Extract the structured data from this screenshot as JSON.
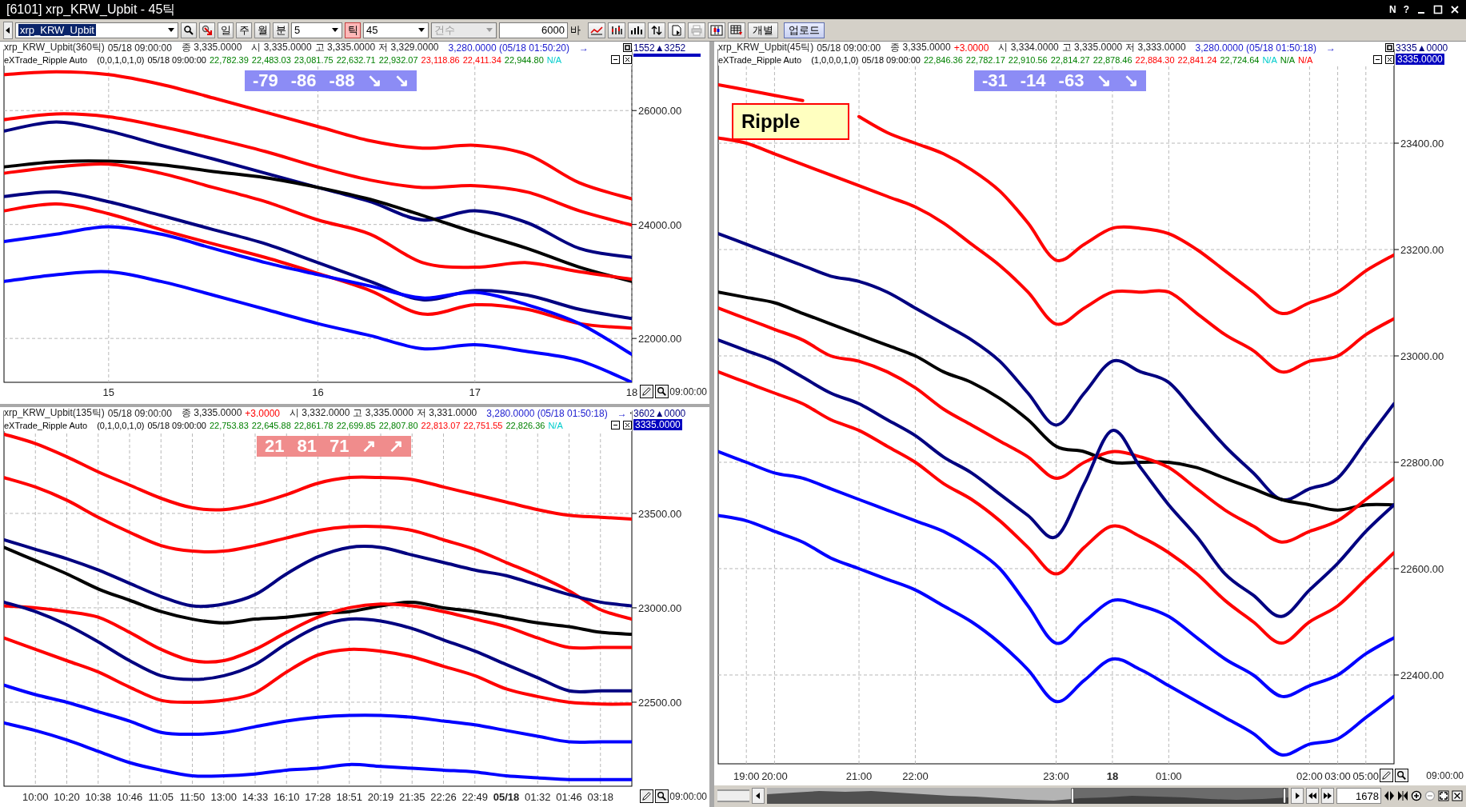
{
  "window": {
    "title": "[6101] xrp_KRW_Upbit - 45틱",
    "buttons": [
      "N",
      "?"
    ]
  },
  "toolbar": {
    "symbol": "xrp_KRW_Upbit",
    "periods": [
      {
        "label": "일",
        "selected": false
      },
      {
        "label": "주",
        "selected": false
      },
      {
        "label": "월",
        "selected": false
      },
      {
        "label": "분",
        "selected": false
      }
    ],
    "minute_value": "5",
    "tick": {
      "label": "틱",
      "selected": true
    },
    "tick_value": "45",
    "count": {
      "label": "건수",
      "disabled": true
    },
    "bars": "6000",
    "bars_unit": "바",
    "individual": "개별",
    "upload": "업로드"
  },
  "panels": [
    {
      "header": {
        "symbol": "xrp_KRW_Upbit(360틱)",
        "datetime": "05/18 09:00:00",
        "close": "종 3,335.0000",
        "ohlc": [
          "시 3,335.0000",
          "고 3,335.0000",
          "저 3,329.0000"
        ],
        "ref": "3,280.0000 (05/18 01:50:20)",
        "arrow": "→"
      },
      "indicator": {
        "name": "eXTrade_Ripple Auto",
        "params": "(0,0,1,0,1,0)",
        "datetime": "05/18 09:00:00",
        "values": [
          {
            "text": "22,782.39",
            "color": "#008000"
          },
          {
            "text": "22,483.03",
            "color": "#008000"
          },
          {
            "text": "23,081.75",
            "color": "#008000"
          },
          {
            "text": "22,632.71",
            "color": "#008000"
          },
          {
            "text": "22,932.07",
            "color": "#008000"
          },
          {
            "text": "23,118.86",
            "color": "#ff0000"
          },
          {
            "text": "22,411.34",
            "color": "#ff0000"
          },
          {
            "text": "22,944.80",
            "color": "#008000"
          },
          {
            "text": "N/A",
            "color": "#00cccc"
          }
        ]
      },
      "signal": {
        "color": "#8c8cf5",
        "items": [
          "-79",
          "-86",
          "-88",
          "↘",
          "↘"
        ]
      },
      "axis_mark": "1552▲3252",
      "time": "09:00:00",
      "chart_data": {
        "type": "line",
        "grid": true,
        "ylim": [
          21230,
          27070
        ],
        "categories": [
          null,
          null,
          "15",
          null,
          null,
          null,
          "16",
          null,
          null,
          "17",
          null,
          null,
          "18"
        ],
        "yticks": [
          {
            "value": 22000,
            "label": "22000.00"
          },
          {
            "value": 24000,
            "label": "24000.00"
          },
          {
            "value": 26000,
            "label": "26000.00"
          }
        ],
        "series": [
          {
            "color": "#ff0000",
            "values": [
              26630,
              26680,
              26630,
              26460,
              26220,
              25970,
              25720,
              25470,
              25340,
              25390,
              25230,
              24730,
              24450
            ]
          },
          {
            "color": "#ff0000",
            "values": [
              25840,
              25940,
              25890,
              25720,
              25510,
              25280,
              25010,
              24780,
              24650,
              24680,
              24570,
              24240,
              23990
            ]
          },
          {
            "color": "#000080",
            "values": [
              25640,
              25800,
              25640,
              25390,
              25150,
              24900,
              24650,
              24400,
              24080,
              24240,
              24030,
              23580,
              23420
            ]
          },
          {
            "color": "#000000",
            "values": [
              25010,
              25100,
              25110,
              25050,
              24930,
              24820,
              24650,
              24440,
              24160,
              23860,
              23580,
              23250,
              23000
            ]
          },
          {
            "color": "#ff0000",
            "values": [
              24900,
              25010,
              25060,
              24900,
              24650,
              24400,
              24080,
              23830,
              23330,
              23250,
              23330,
              23170,
              23040
            ]
          },
          {
            "color": "#000080",
            "values": [
              24490,
              24570,
              24400,
              24160,
              23910,
              23660,
              23330,
              23000,
              22680,
              22840,
              22760,
              22510,
              22350
            ]
          },
          {
            "color": "#ff0000",
            "values": [
              24240,
              24360,
              24190,
              23910,
              23660,
              23420,
              23140,
              22840,
              22430,
              22590,
              22510,
              22260,
              22180
            ]
          },
          {
            "color": "#0000ff",
            "values": [
              23700,
              23830,
              23960,
              23830,
              23580,
              23330,
              23120,
              22920,
              22710,
              22810,
              22590,
              22260,
              21720
            ]
          },
          {
            "color": "#0000ff",
            "values": [
              23000,
              23120,
              23170,
              23000,
              22760,
              22510,
              22260,
              22050,
              21820,
              21890,
              21770,
              21610,
              21230
            ]
          }
        ]
      }
    },
    {
      "header": {
        "symbol": "xrp_KRW_Upbit(135틱)",
        "datetime": "05/18 09:00:00",
        "close": "종 3,335.0000",
        "change": "+3.0000",
        "ohlc": [
          "시 3,332.0000",
          "고 3,335.0000",
          "저 3,331.0000"
        ],
        "ref": "3,280.0000 (05/18 01:50:18)",
        "arrow": "→"
      },
      "indicator": {
        "name": "eXTrade_Ripple Auto",
        "params": "(0,1,0,0,1,0)",
        "datetime": "05/18 09:00:00",
        "values": [
          {
            "text": "22,753.83",
            "color": "#008000"
          },
          {
            "text": "22,645.88",
            "color": "#008000"
          },
          {
            "text": "22,861.78",
            "color": "#008000"
          },
          {
            "text": "22,699.85",
            "color": "#008000"
          },
          {
            "text": "22,807.80",
            "color": "#008000"
          },
          {
            "text": "22,813.07",
            "color": "#ff0000"
          },
          {
            "text": "22,751.55",
            "color": "#ff0000"
          },
          {
            "text": "22,826.36",
            "color": "#008000"
          },
          {
            "text": "N/A",
            "color": "#00cccc"
          }
        ]
      },
      "signal": {
        "color": "#f08c8c",
        "items": [
          "21",
          "81",
          "71",
          "↗",
          "↗"
        ]
      },
      "axis_mark": "3602▲0000",
      "price": "3335.0000",
      "time": "09:00:00",
      "chart_data": {
        "type": "line",
        "grid": true,
        "ylim": [
          22055,
          24042
        ],
        "categories": [
          null,
          "10:00",
          "10:20",
          "10:38",
          "10:46",
          "11:05",
          "11:50",
          "13:00",
          "14:33",
          "16:10",
          "17:28",
          "18:51",
          "20:19",
          "21:35",
          "22:26",
          "22:49",
          "**05/18**",
          "01:32",
          "01:46",
          "03:18",
          null
        ],
        "yticks": [
          {
            "value": 22500,
            "label": "22500.00"
          },
          {
            "value": 23000,
            "label": "23000.00"
          },
          {
            "value": 23500,
            "label": "23500.00"
          }
        ],
        "series": [
          {
            "color": "#ff0000",
            "values": [
              23920,
              23870,
              23800,
              23720,
              23650,
              23580,
              23530,
              23520,
              23550,
              23600,
              23660,
              23690,
              23690,
              23680,
              23640,
              23600,
              23560,
              23520,
              23490,
              23480,
              23470
            ]
          },
          {
            "color": "#ff0000",
            "values": [
              23690,
              23640,
              23570,
              23480,
              23400,
              23330,
              23300,
              23300,
              23330,
              23370,
              23410,
              23430,
              23430,
              23410,
              23360,
              23310,
              23240,
              23170,
              23090,
              22990,
              22940
            ]
          },
          {
            "color": "#000080",
            "values": [
              23360,
              23310,
              23260,
              23200,
              23130,
              23060,
              23010,
              23020,
              23070,
              23180,
              23270,
              23320,
              23320,
              23280,
              23240,
              23200,
              23170,
              23120,
              23070,
              23030,
              23010
            ]
          },
          {
            "color": "#000000",
            "values": [
              23320,
              23250,
              23180,
              23100,
              23040,
              22980,
              22940,
              22920,
              22940,
              22950,
              22970,
              22980,
              23010,
              23030,
              23000,
              22980,
              22950,
              22920,
              22900,
              22870,
              22860
            ]
          },
          {
            "color": "#ff0000",
            "values": [
              23010,
              23000,
              22980,
              22950,
              22870,
              22780,
              22720,
              22720,
              22780,
              22870,
              22950,
              23000,
              23020,
              23010,
              22980,
              22940,
              22900,
              22840,
              22790,
              22790,
              22790
            ]
          },
          {
            "color": "#000080",
            "values": [
              23030,
              22980,
              22910,
              22820,
              22720,
              22640,
              22620,
              22640,
              22700,
              22810,
              22900,
              22940,
              22930,
              22890,
              22830,
              22770,
              22700,
              22630,
              22560,
              22560,
              22560
            ]
          },
          {
            "color": "#ff0000",
            "values": [
              22840,
              22780,
              22720,
              22660,
              22580,
              22510,
              22500,
              22510,
              22550,
              22660,
              22750,
              22780,
              22770,
              22740,
              22690,
              22640,
              22570,
              22530,
              22500,
              22490,
              22490
            ]
          },
          {
            "color": "#0000ff",
            "values": [
              22590,
              22540,
              22500,
              22450,
              22400,
              22340,
              22330,
              22340,
              22370,
              22400,
              22420,
              22430,
              22430,
              22420,
              22400,
              22380,
              22350,
              22320,
              22290,
              22290,
              22290
            ]
          },
          {
            "color": "#0000ff",
            "values": [
              22390,
              22350,
              22300,
              22240,
              22180,
              22140,
              22110,
              22110,
              22120,
              22140,
              22150,
              22170,
              22160,
              22150,
              22140,
              22130,
              22110,
              22100,
              22090,
              22090,
              22090
            ]
          }
        ]
      }
    },
    {
      "header": {
        "symbol": "xrp_KRW_Upbit(45틱)",
        "datetime": "05/18 09:00:00",
        "close": "종 3,335.0000",
        "change": "+3.0000",
        "ohlc": [
          "시 3,334.0000",
          "고 3,335.0000",
          "저 3,333.0000"
        ],
        "ref": "3,280.0000 (05/18 01:50:18)",
        "arrow": "→"
      },
      "indicator": {
        "name": "eXTrade_Ripple Auto",
        "params": "(1,0,0,0,1,0)",
        "datetime": "05/18 09:00:00",
        "values": [
          {
            "text": "22,846.36",
            "color": "#008000"
          },
          {
            "text": "22,782.17",
            "color": "#008000"
          },
          {
            "text": "22,910.56",
            "color": "#008000"
          },
          {
            "text": "22,814.27",
            "color": "#008000"
          },
          {
            "text": "22,878.46",
            "color": "#008000"
          },
          {
            "text": "22,884.30",
            "color": "#ff0000"
          },
          {
            "text": "22,841.24",
            "color": "#ff0000"
          },
          {
            "text": "22,724.64",
            "color": "#008000"
          },
          {
            "text": "N/A",
            "color": "#00cccc"
          },
          {
            "text": "N/A",
            "color": "#008000"
          },
          {
            "text": "N/A",
            "color": "#ff0000"
          }
        ]
      },
      "signal": {
        "color": "#8c8cf5",
        "items": [
          "-31",
          "-14",
          "-63",
          "↘",
          "↘"
        ]
      },
      "label": "Ripple",
      "axis_mark": "3335▲0000",
      "price": "3335.0000",
      "time": "09:00:00",
      "chart_data": {
        "type": "line",
        "grid": true,
        "ylim": [
          22233,
          23576
        ],
        "categories": [
          null,
          "19:00",
          "20:00",
          null,
          null,
          "21:00",
          null,
          "22:00",
          null,
          null,
          null,
          null,
          "23:00",
          null,
          "**18**",
          null,
          "01:00",
          null,
          null,
          null,
          null,
          "02:00",
          "03:00",
          "05:00",
          null
        ],
        "yticks": [
          {
            "value": 22400,
            "label": "22400.00"
          },
          {
            "value": 22600,
            "label": "22600.00"
          },
          {
            "value": 22800,
            "label": "22800.00"
          },
          {
            "value": 23000,
            "label": "23000.00"
          },
          {
            "value": 23200,
            "label": "23200.00"
          },
          {
            "value": 23400,
            "label": "23400.00"
          }
        ],
        "series": [
          {
            "color": "#ff0000",
            "values": [
              23510,
              23500,
              23490,
              23480,
              null,
              23450,
              23420,
              23400,
              23380,
              23350,
              23310,
              23250,
              23180,
              23210,
              23240,
              23240,
              23230,
              23200,
              23160,
              23120,
              23080,
              23100,
              23120,
              23160,
              23190
            ]
          },
          {
            "color": "#ff0000",
            "values": [
              23410,
              23400,
              23380,
              23360,
              23340,
              23320,
              23300,
              23280,
              23250,
              23210,
              23170,
              23120,
              23060,
              23090,
              23120,
              23120,
              23120,
              23080,
              23040,
              23010,
              22970,
              22990,
              23000,
              23040,
              23070
            ]
          },
          {
            "color": "#000080",
            "values": [
              23230,
              23210,
              23190,
              23170,
              23150,
              23140,
              23120,
              23090,
              23060,
              23030,
              22990,
              22930,
              22870,
              22930,
              22990,
              22970,
              22950,
              22890,
              22830,
              22780,
              22730,
              22750,
              22770,
              22840,
              22910
            ]
          },
          {
            "color": "#000000",
            "values": [
              23120,
              23110,
              23100,
              23080,
              23060,
              23040,
              23020,
              23000,
              22970,
              22950,
              22920,
              22880,
              22830,
              22820,
              22800,
              22800,
              22800,
              22790,
              22770,
              22750,
              22730,
              22720,
              22710,
              22720,
              22720
            ]
          },
          {
            "color": "#ff0000",
            "values": [
              23090,
              23070,
              23050,
              23030,
              23000,
              22990,
              22970,
              22940,
              22900,
              22870,
              22840,
              22810,
              22770,
              22800,
              22820,
              22810,
              22790,
              22750,
              22710,
              22680,
              22650,
              22670,
              22690,
              22730,
              22770
            ]
          },
          {
            "color": "#000080",
            "values": [
              23030,
              23010,
              22990,
              22960,
              22930,
              22910,
              22880,
              22850,
              22810,
              22780,
              22740,
              22700,
              22660,
              22760,
              22860,
              22790,
              22720,
              22660,
              22590,
              22550,
              22510,
              22560,
              22610,
              22670,
              22720
            ]
          },
          {
            "color": "#ff0000",
            "values": [
              22970,
              22950,
              22930,
              22910,
              22880,
              22860,
              22830,
              22800,
              22760,
              22730,
              22690,
              22640,
              22590,
              22640,
              22680,
              22660,
              22630,
              22590,
              22540,
              22500,
              22460,
              22500,
              22530,
              22580,
              22630
            ]
          },
          {
            "color": "#0000ff",
            "values": [
              22820,
              22800,
              22780,
              22770,
              22750,
              22730,
              22710,
              22690,
              22670,
              22640,
              22600,
              22530,
              22460,
              22500,
              22540,
              22530,
              22510,
              22470,
              22430,
              22400,
              22360,
              22380,
              22400,
              22440,
              22470
            ]
          },
          {
            "color": "#0000ff",
            "values": [
              22700,
              22690,
              22670,
              22650,
              22620,
              22600,
              22580,
              22560,
              22530,
              22500,
              22460,
              22410,
              22350,
              22390,
              22430,
              22410,
              22380,
              22350,
              22320,
              22290,
              22250,
              22270,
              22280,
              22320,
              22360
            ]
          }
        ]
      }
    }
  ],
  "navigator": {
    "count": "1678"
  }
}
